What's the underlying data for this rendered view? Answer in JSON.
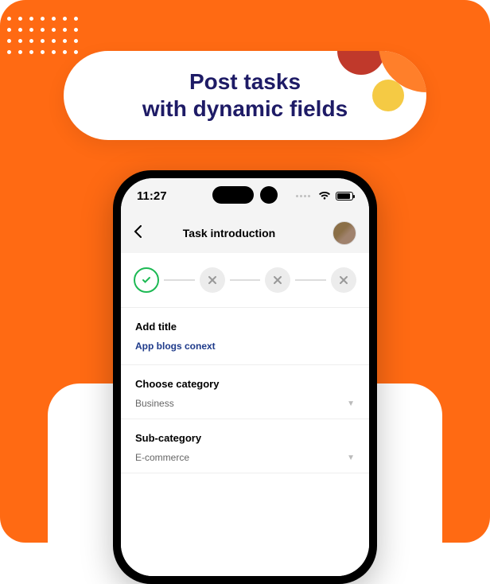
{
  "promo": {
    "line1": "Post tasks",
    "line2": "with dynamic fields"
  },
  "status": {
    "time": "11:27"
  },
  "header": {
    "title": "Task introduction"
  },
  "form": {
    "title_label": "Add title",
    "title_value": "App blogs conext",
    "category_label": "Choose category",
    "category_value": "Business",
    "subcategory_label": "Sub-category",
    "subcategory_value": "E-commerce"
  }
}
